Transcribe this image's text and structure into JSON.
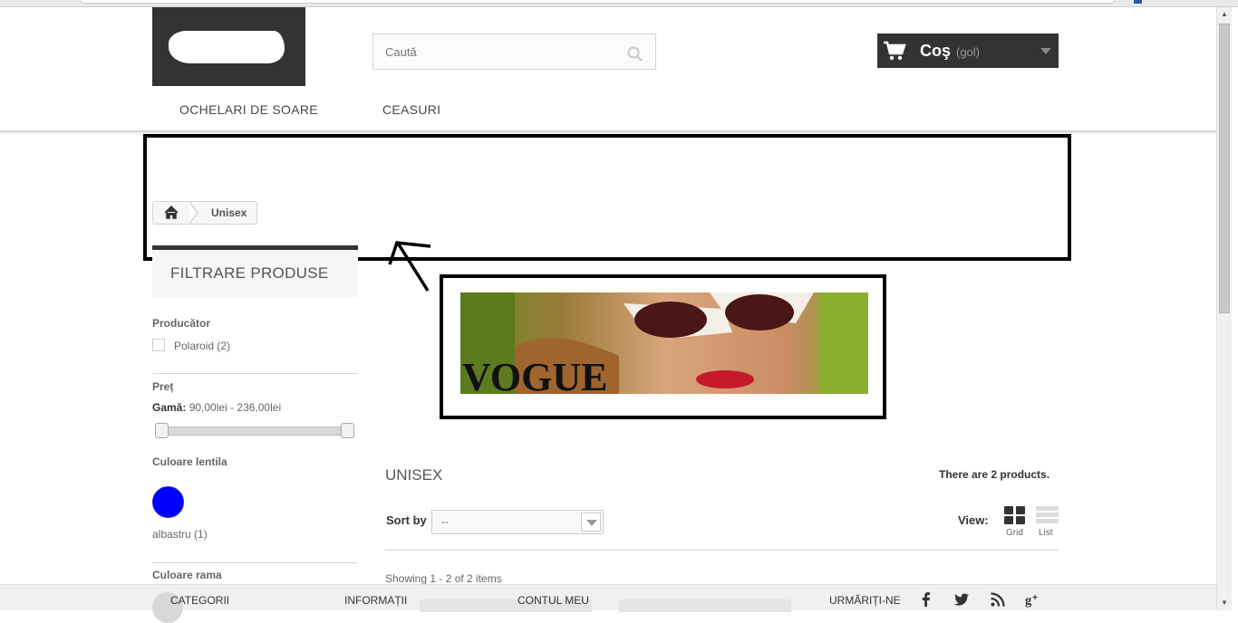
{
  "header": {
    "search_placeholder": "Caută",
    "cart_label": "Coş",
    "cart_status": "(gol)",
    "menu": [
      "OCHELARI DE SOARE",
      "CEASURI"
    ]
  },
  "breadcrumb": {
    "current": "Unisex"
  },
  "sidebar": {
    "title": "FILTRARE PRODUSE",
    "manufacturer_label": "Producător",
    "manufacturer_option": "Polaroid (2)",
    "price_label": "Preț",
    "range_label": "Gamă:",
    "range_value": "90,00lei - 236,00lei",
    "price_range": [
      90,
      236
    ],
    "lens_color_label": "Culoare lentila",
    "lens_color_option": "albastru (1)",
    "lens_swatch_color": "#0000ff",
    "frame_color_label": "Culoare rama"
  },
  "banner": {
    "text": "VOGUE"
  },
  "main": {
    "category_name": "UNISEX",
    "product_count": "There are 2 products.",
    "sort_label": "Sort by",
    "sort_value": "--",
    "view_label": "View:",
    "view_grid": "Grid",
    "view_list": "List",
    "showing": "Showing 1 - 2 of 2 items"
  },
  "footer": {
    "links": [
      "CATEGORII",
      "INFORMAȚII",
      "CONTUL MEU"
    ],
    "follow": "URMĂRIȚI-NE",
    "social_icons": [
      "facebook-icon",
      "twitter-icon",
      "rss-icon",
      "google-plus-icon"
    ]
  },
  "colors": {
    "dark": "#333333",
    "annotation": "#000000"
  }
}
